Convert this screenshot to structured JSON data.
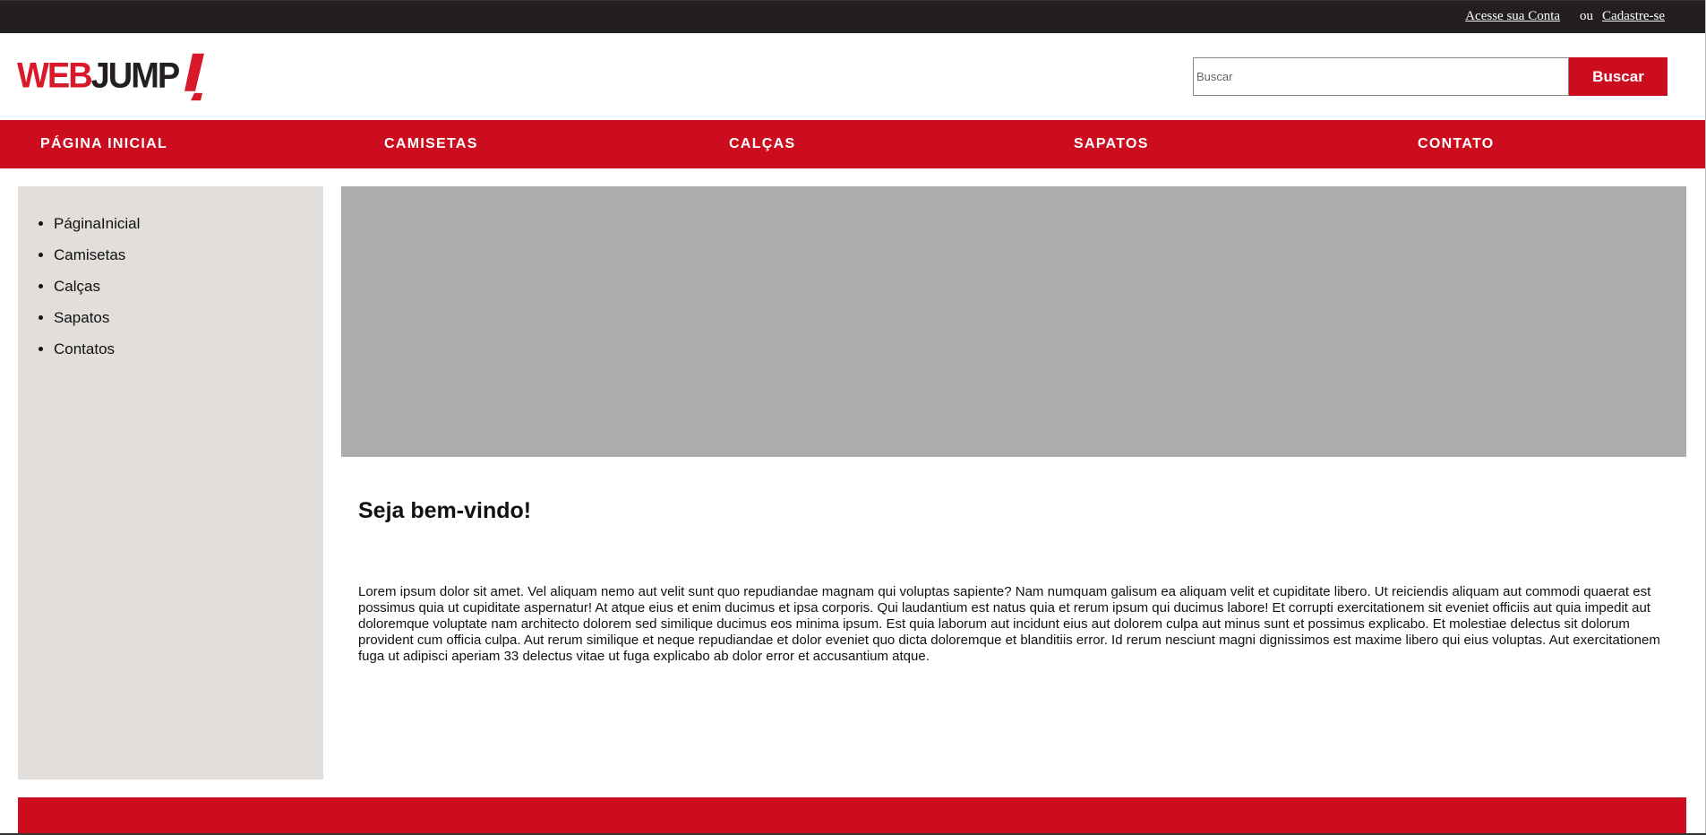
{
  "topbar": {
    "account_link": "Acesse sua Conta",
    "separator": "ou",
    "signup_link": "Cadastre-se"
  },
  "header": {
    "logo": {
      "part1": "WEB",
      "part2": "JUMP"
    },
    "search": {
      "placeholder": "Buscar",
      "button_label": "Buscar"
    }
  },
  "nav": {
    "items": [
      {
        "label": "PÁGINA INICIAL"
      },
      {
        "label": "CAMISETAS"
      },
      {
        "label": "CALÇAS"
      },
      {
        "label": "SAPATOS"
      },
      {
        "label": "CONTATO"
      }
    ]
  },
  "sidebar": {
    "items": [
      {
        "label": "PáginaInicial"
      },
      {
        "label": "Camisetas"
      },
      {
        "label": "Calças"
      },
      {
        "label": "Sapatos"
      },
      {
        "label": "Contatos"
      }
    ]
  },
  "main": {
    "title": "Seja bem-vindo!",
    "body": "Lorem ipsum dolor sit amet. Vel aliquam nemo aut velit sunt quo repudiandae magnam qui voluptas sapiente? Nam numquam galisum ea aliquam velit et cupiditate libero. Ut reiciendis aliquam aut commodi quaerat est possimus quia ut cupiditate aspernatur! At atque eius et enim ducimus et ipsa corporis. Qui laudantium est natus quia et rerum ipsum qui ducimus labore! Et corrupti exercitationem sit eveniet officiis aut quia impedit aut doloremque voluptate nam architecto dolorem sed similique ducimus eos minima ipsum. Est quia laborum aut incidunt eius aut dolorem culpa aut minus sunt et possimus explicabo. Et molestiae delectus sit dolorum provident cum officia culpa. Aut rerum similique et neque repudiandae et dolor eveniet quo dicta doloremque et blanditiis error. Id rerum nesciunt magni dignissimos est maxime libero qui eius voluptas. Aut exercitationem fuga ut adipisci aperiam 33 delectus vitae ut fuga explicabo ab dolor error et accusantium atque."
  },
  "colors": {
    "brand_red": "#cc0d1f",
    "topbar_dark": "#231f20",
    "sidebar_bg": "#e1dedb",
    "banner_gray": "#acacac"
  },
  "icons": {
    "logo_mark": "slanted-exclamation-icon"
  }
}
